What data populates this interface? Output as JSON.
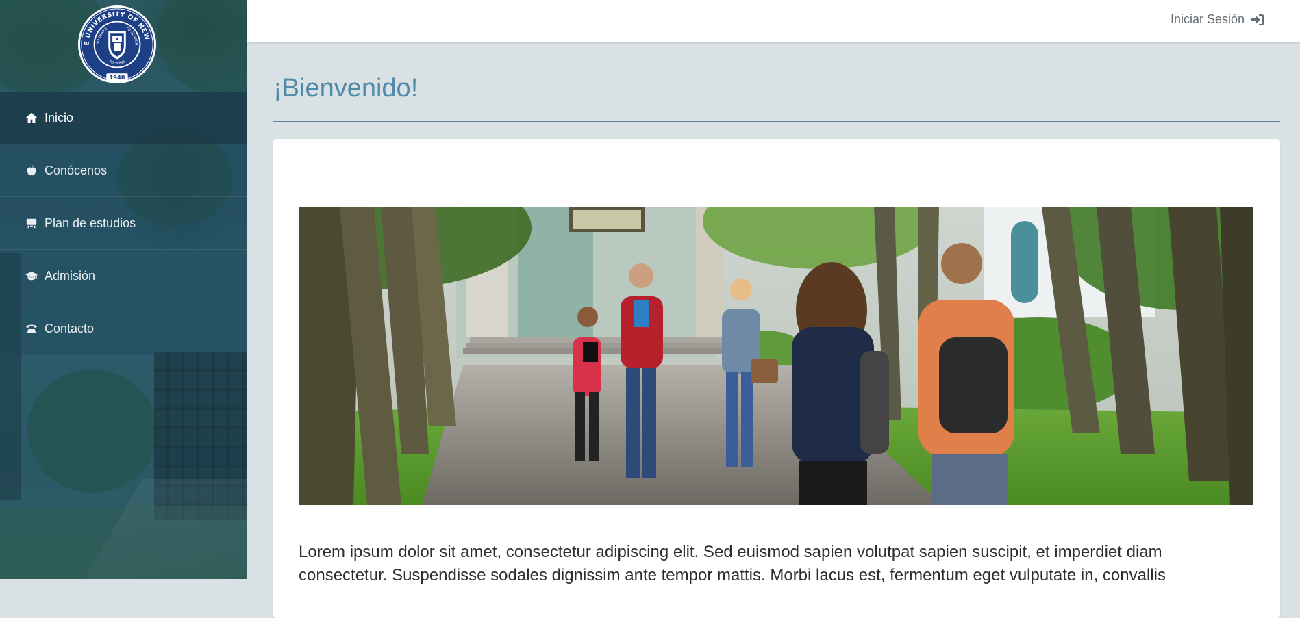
{
  "sidebar": {
    "logo": {
      "ring_text_top": "STATE UNIVERSITY OF NEW YORK",
      "motto_left": "TO LEARN",
      "motto_right": "TO SEARCH",
      "motto_bottom": "TO SERVE",
      "year": "1948"
    },
    "items": [
      {
        "label": "Inicio",
        "icon": "home-icon",
        "active": true
      },
      {
        "label": "Conócenos",
        "icon": "apple-icon",
        "active": false
      },
      {
        "label": "Plan de estudios",
        "icon": "blackboard-icon",
        "active": false
      },
      {
        "label": "Admisión",
        "icon": "graduation-cap-icon",
        "active": false
      },
      {
        "label": "Contacto",
        "icon": "phone-icon",
        "active": false
      }
    ]
  },
  "header": {
    "login_label": "Iniciar Sesión",
    "login_icon": "sign-in-icon"
  },
  "main": {
    "title": "¡Bienvenido!",
    "body_text": "Lorem ipsum dolor sit amet, consectetur adipiscing elit. Sed euismod sapien volutpat sapien suscipit, et imperdiet diam consectetur. Suspendisse sodales dignissim ante tempor mattis. Morbi lacus est, fermentum eget vulputate in, convallis"
  },
  "colors": {
    "accent": "#4e8aaa",
    "sidebar_bg": "#2b5866",
    "page_bg": "#d9e1e5",
    "seal_blue": "#1d3f86"
  }
}
